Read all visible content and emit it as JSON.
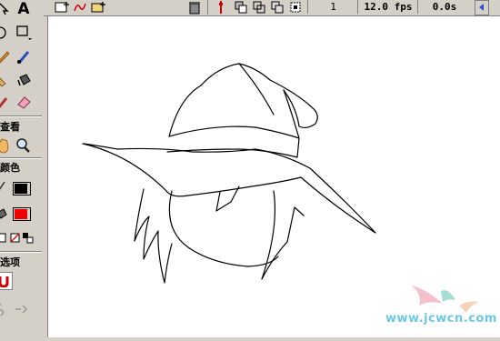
{
  "toolbox": {
    "section_view": "查看",
    "section_color": "颜色",
    "section_options": "选项",
    "top_tool_text": "A",
    "stroke_color": "#000000",
    "fill_color": "#ee0000"
  },
  "timeline": {
    "frame": "1",
    "fps": "12.0 fps",
    "time": "0.0s"
  },
  "watermark": "www.jcwcn.com",
  "colors": {
    "panel": "#d4d0c8",
    "stage": "#ffffff",
    "accent_red": "#cc0000"
  }
}
